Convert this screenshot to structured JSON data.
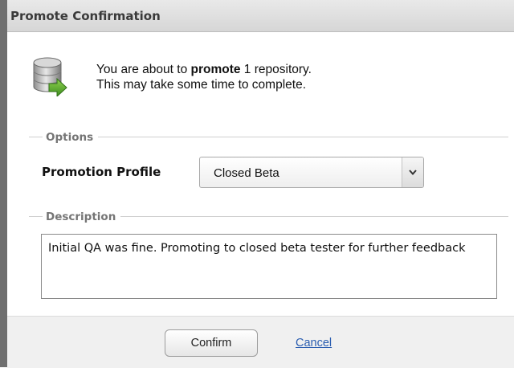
{
  "dialog": {
    "title": "Promote Confirmation"
  },
  "message": {
    "prefix": "You are about to ",
    "action": "promote",
    "suffix": " 1 repository.",
    "line2": "This may take some time to complete."
  },
  "options": {
    "legend": "Options",
    "promotion_profile_label": "Promotion Profile",
    "promotion_profile_value": "Closed Beta"
  },
  "description": {
    "legend": "Description",
    "text": "Initial QA was fine. Promoting to closed beta tester for further feedback"
  },
  "footer": {
    "confirm_label": "Confirm",
    "cancel_label": "Cancel"
  },
  "icons": {
    "message_icon": "database-promote-icon",
    "select_arrow": "chevron-down-icon"
  }
}
